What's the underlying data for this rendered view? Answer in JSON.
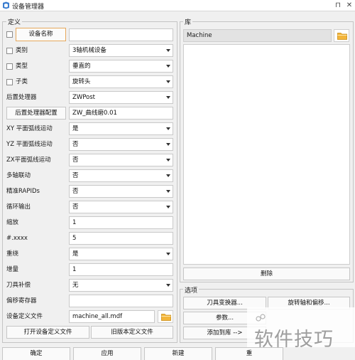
{
  "window": {
    "title": "设备管理器",
    "pin_glyph": "⊓",
    "close_glyph": "✕"
  },
  "definition": {
    "title": "定义",
    "device_name_button": "设备名称",
    "device_name_value": "",
    "category_label": "类别",
    "category_value": "3轴机械设备",
    "type_label": "类型",
    "type_value": "垂直的",
    "subtype_label": "子类",
    "subtype_value": "旋转头",
    "postprocessor_label": "后置处理器",
    "postprocessor_value": "ZWPost",
    "pp_config_button": "后置处理器配置",
    "pp_config_value": "ZW_曲线磨0.01",
    "xy_arc_label": "XY 平面弧线运动",
    "xy_arc_value": "是",
    "yz_arc_label": "YZ 平面弧线运动",
    "yz_arc_value": "否",
    "zx_arc_label": "ZX平面弧线运动",
    "zx_arc_value": "否",
    "multiaxis_label": "多轴联动",
    "multiaxis_value": "否",
    "rapids_label": "精准RAPIDs",
    "rapids_value": "否",
    "loop_label": "循环输出",
    "loop_value": "否",
    "scale_label": "缩放",
    "scale_value": "1",
    "xxxx_label": "#.xxxx",
    "xxxx_value": "5",
    "repeat_label": "重绕",
    "repeat_value": "是",
    "increment_label": "增量",
    "increment_value": "1",
    "tool_comp_label": "刀具补偿",
    "tool_comp_value": "无",
    "offset_reg_label": "偏移寄存器",
    "offset_reg_value": "",
    "def_file_label": "设备定义文件",
    "def_file_value": "machine_all.mdf",
    "open_def_button": "打开设备定义文件",
    "old_def_button": "旧版本定义文件"
  },
  "library": {
    "title": "库",
    "selected": "Machine",
    "delete_button": "删除"
  },
  "options": {
    "title": "选项",
    "tool_changer_button": "刀具变换器...",
    "rotary_button": "旋转轴和偏移...",
    "params_button": "参数...",
    "add_to_lib_button": "添加到库 -->"
  },
  "bottom": {
    "ok_button": "确定",
    "apply_button": "应用",
    "new_button": "新建",
    "fourth_button_visible": "重"
  },
  "watermark": {
    "text": "软件技巧"
  },
  "colors": {
    "focus_border": "#e6a75b",
    "folder": "#f3b53a",
    "title_icon": "#3d7fd0"
  },
  "icons": [
    "app-icon",
    "pin-icon",
    "close-icon",
    "folder-icon",
    "watermark-icon"
  ]
}
